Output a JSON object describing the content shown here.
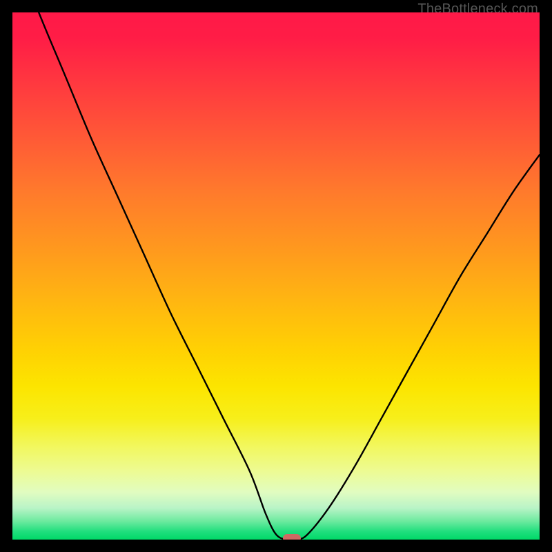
{
  "attribution": "TheBottleneck.com",
  "colors": {
    "frame": "#000000",
    "curve": "#000000",
    "marker": "#cf6a63"
  },
  "chart_data": {
    "type": "line",
    "title": "",
    "xlabel": "",
    "ylabel": "",
    "xlim": [
      0,
      100
    ],
    "ylim": [
      0,
      100
    ],
    "series": [
      {
        "name": "bottleneck-curve",
        "x": [
          0,
          5,
          10,
          15,
          20,
          25,
          30,
          35,
          40,
          45,
          48,
          50,
          52,
          54,
          56,
          60,
          65,
          70,
          75,
          80,
          85,
          90,
          95,
          100
        ],
        "y": [
          113,
          100,
          88,
          76,
          65,
          54,
          43,
          33,
          23,
          13,
          5,
          1,
          0,
          0,
          1,
          6,
          14,
          23,
          32,
          41,
          50,
          58,
          66,
          73
        ]
      }
    ],
    "minimum": {
      "x": 53,
      "y": 0
    },
    "background_gradient": {
      "stops": [
        {
          "pos": 0.0,
          "color": "#ff1948"
        },
        {
          "pos": 0.5,
          "color": "#ffb412"
        },
        {
          "pos": 0.8,
          "color": "#f2f75a"
        },
        {
          "pos": 1.0,
          "color": "#00d968"
        }
      ],
      "meaning": "top = high bottleneck (red), bottom = low (green)"
    },
    "grid": false,
    "legend": false
  }
}
